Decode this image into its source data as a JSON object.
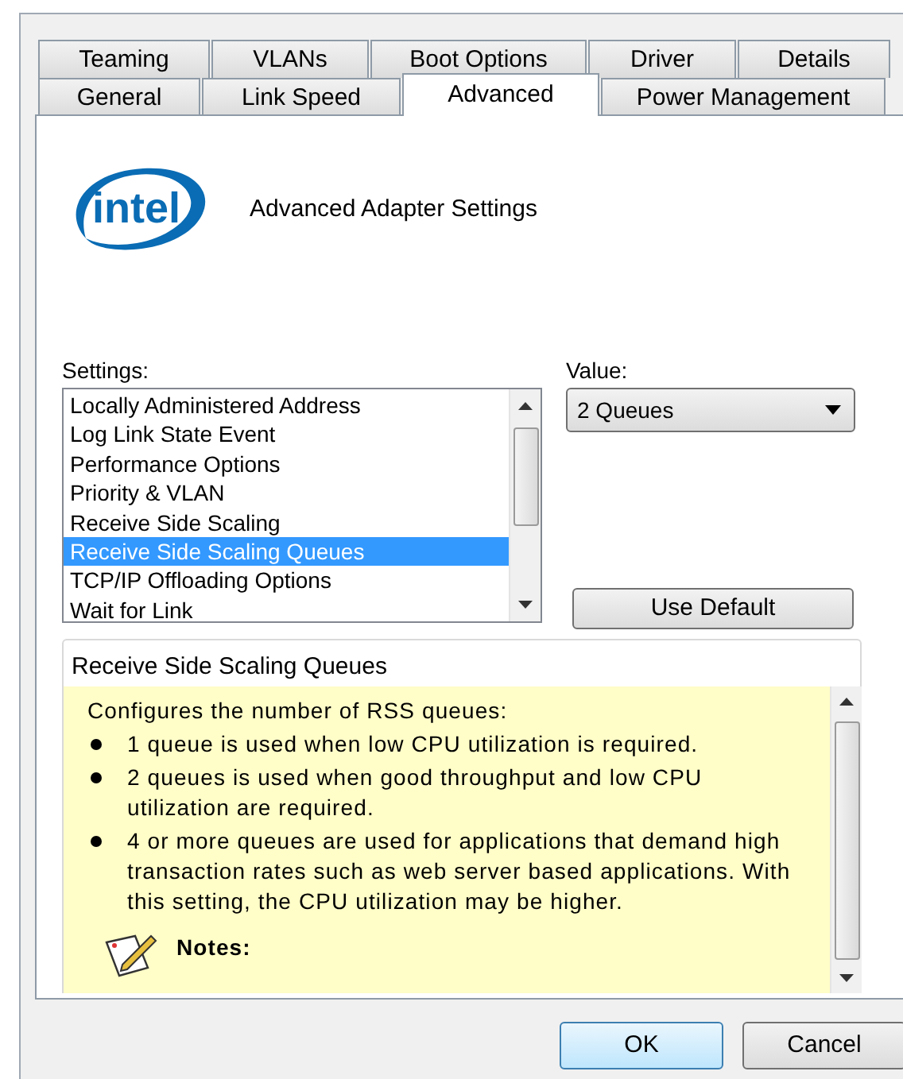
{
  "tabs_row_1": [
    {
      "label": "Teaming",
      "selected": false
    },
    {
      "label": "VLANs",
      "selected": false
    },
    {
      "label": "Boot Options",
      "selected": false
    },
    {
      "label": "Driver",
      "selected": false
    },
    {
      "label": "Details",
      "selected": false
    }
  ],
  "tabs_row_2": [
    {
      "label": "General",
      "selected": false
    },
    {
      "label": "Link Speed",
      "selected": false
    },
    {
      "label": "Advanced",
      "selected": true
    },
    {
      "label": "Power Management",
      "selected": false
    }
  ],
  "header": {
    "logo_text": "intel",
    "title": "Advanced Adapter Settings"
  },
  "settings": {
    "label": "Settings:",
    "items": [
      {
        "label": "Locally Administered Address",
        "selected": false
      },
      {
        "label": "Log Link State Event",
        "selected": false
      },
      {
        "label": "Performance Options",
        "selected": false
      },
      {
        "label": "Priority & VLAN",
        "selected": false
      },
      {
        "label": "Receive Side Scaling",
        "selected": false
      },
      {
        "label": "Receive Side Scaling Queues",
        "selected": true
      },
      {
        "label": "TCP/IP Offloading Options",
        "selected": false
      },
      {
        "label": "Wait for Link",
        "selected": false
      }
    ]
  },
  "value": {
    "label": "Value:",
    "value": "2 Queues"
  },
  "use_default_button": "Use Default",
  "description": {
    "title": "Receive Side Scaling Queues",
    "intro": "Configures the number of RSS queues:",
    "bullets": [
      "1 queue is used when low CPU utilization is required.",
      "2 queues is used when good throughput and low CPU utilization are required.",
      "4 or more queues are used for applications that demand high transaction rates such as web server based applications. With this setting, the CPU utilization may be higher."
    ],
    "notes_label": "Notes:"
  },
  "buttons": [
    {
      "label": "OK",
      "kind": "default"
    },
    {
      "label": "Cancel",
      "kind": "normal"
    }
  ]
}
